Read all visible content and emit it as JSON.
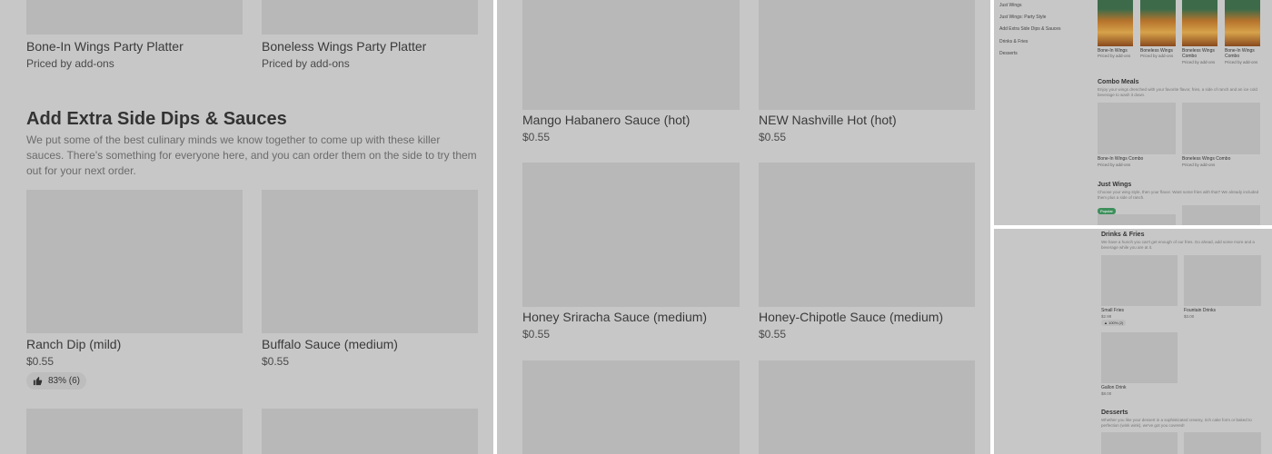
{
  "panel_a": {
    "top_items": [
      {
        "title": "Bone-In Wings Party Platter",
        "price": "Priced by add-ons"
      },
      {
        "title": "Boneless Wings Party Platter",
        "price": "Priced by add-ons"
      }
    ],
    "section": {
      "title": "Add Extra Side Dips & Sauces",
      "description": "We put some of the best culinary minds we know together to come up with these killer sauces. There's something for everyone here, and you can order them on the side to try them out for your next order."
    },
    "items": [
      {
        "title": "Ranch Dip (mild)",
        "price": "$0.55",
        "rating": "83% (6)"
      },
      {
        "title": "Buffalo Sauce (medium)",
        "price": "$0.55"
      }
    ]
  },
  "panel_b": {
    "items": [
      {
        "title": "Mango Habanero Sauce (hot)",
        "price": "$0.55"
      },
      {
        "title": "NEW Nashville Hot (hot)",
        "price": "$0.55"
      },
      {
        "title": "Honey Sriracha Sauce (medium)",
        "price": "$0.55"
      },
      {
        "title": "Honey-Chipotle Sauce (medium)",
        "price": "$0.55"
      }
    ]
  },
  "panel_c": {
    "nav": [
      "Just Wings",
      "Just Wings: Party Style",
      "Add Extra Side Dips & Sauces",
      "Drinks & Fries",
      "Desserts"
    ],
    "featured": [
      {
        "title": "Bone-In Wings",
        "price": "Priced by add-ons"
      },
      {
        "title": "Boneless Wings",
        "price": "Priced by add-ons"
      },
      {
        "title": "Boneless Wings Combo",
        "price": "Priced by add-ons"
      },
      {
        "title": "Bone-In Wings Combo",
        "price": "Priced by add-ons"
      }
    ],
    "combo": {
      "title": "Combo Meals",
      "description": "Enjoy your wings drenched with your favorite flavor, fries, a side of ranch and an ice cold beverage to wash it down.",
      "items": [
        {
          "title": "Bone-In Wings Combo",
          "price": "Priced by add-ons"
        },
        {
          "title": "Boneless Wings Combo",
          "price": "Priced by add-ons"
        }
      ]
    },
    "just_wings": {
      "title": "Just Wings",
      "description": "Choose your wing style, then your flavor. Want some fries with that? We already included them plus a side of ranch.",
      "tag": "Popular"
    }
  },
  "panel_d": {
    "drinks": {
      "title": "Drinks & Fries",
      "description": "We have a hunch you can't get enough of our fries. Go ahead, add some more and a beverage while you are at it.",
      "items": [
        {
          "title": "Small Fries",
          "price": "$2.99",
          "rating": "100% (2)"
        },
        {
          "title": "Fountain Drinks",
          "price": "$3.00"
        },
        {
          "title": "Gallon Drink",
          "price": "$8.00"
        }
      ]
    },
    "desserts": {
      "title": "Desserts",
      "description": "Whether you like your dessert in a sophisticated creamy, rich cake form or baked to perfection (wink wink), we've got you covered!"
    }
  }
}
